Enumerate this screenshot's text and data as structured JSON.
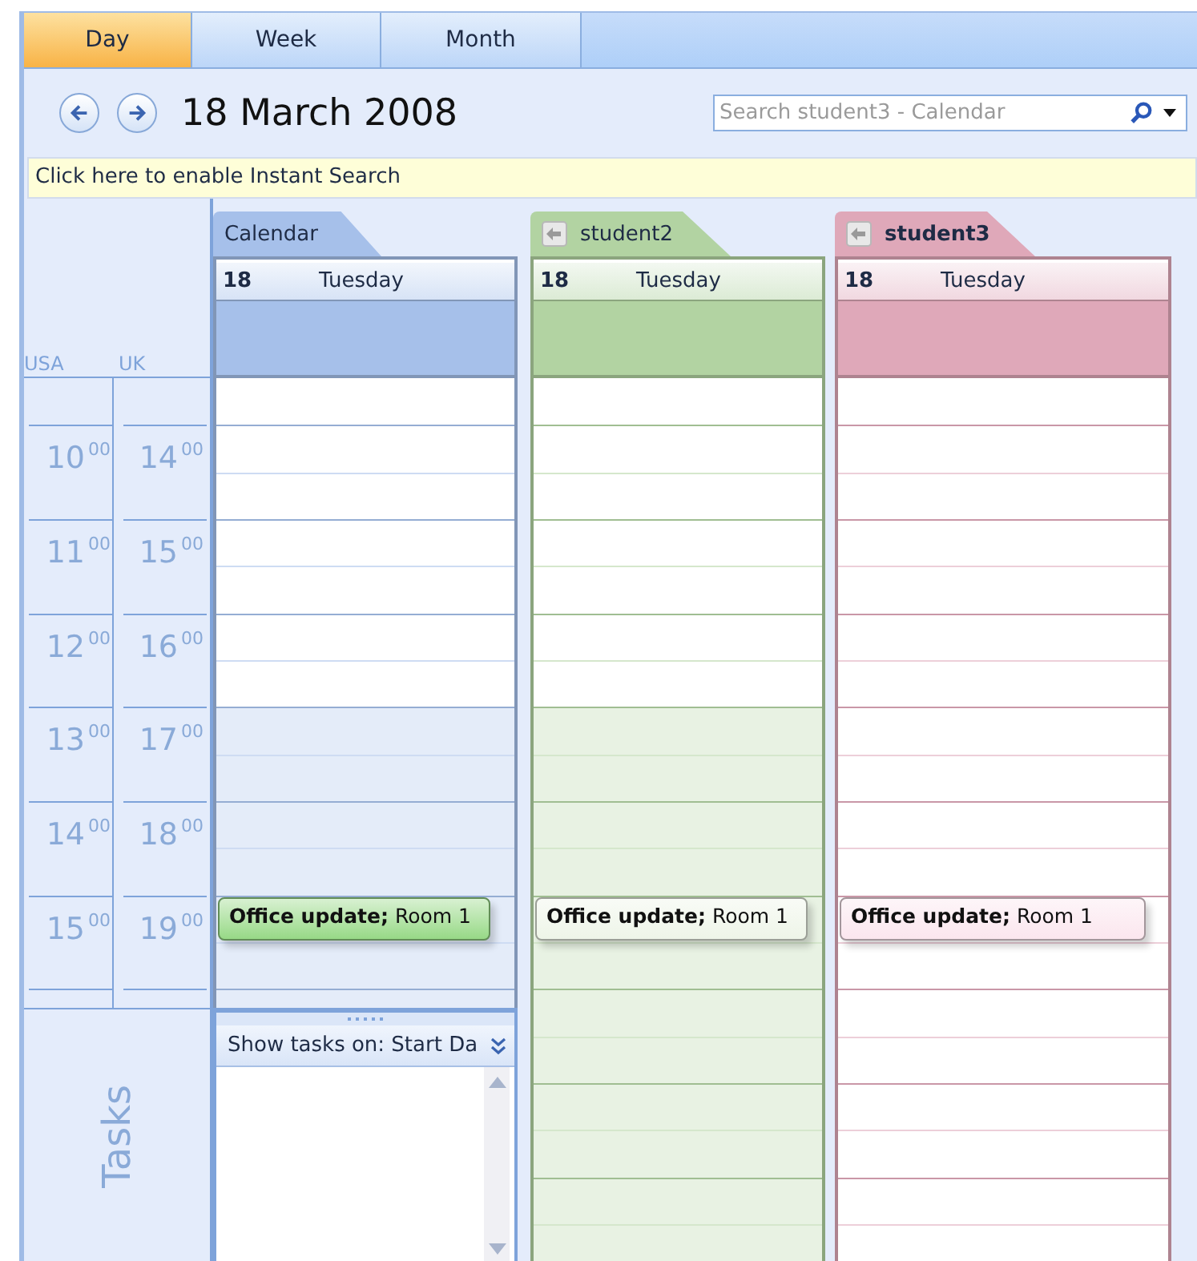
{
  "view_tabs": [
    {
      "label": "Day",
      "selected": true
    },
    {
      "label": "Week",
      "selected": false
    },
    {
      "label": "Month",
      "selected": false
    }
  ],
  "date_title": "18 March 2008",
  "search": {
    "placeholder": "Search student3 - Calendar"
  },
  "instant_search_bar": "Click here to enable Instant Search",
  "time_ruler": {
    "zones": [
      "USA",
      "UK"
    ],
    "hours": [
      {
        "usa": "10$^{00}$",
        "uk": "14$^{00}$"
      },
      {
        "usa": "11$^{00}$",
        "uk": "15$^{00}$"
      },
      {
        "usa": "12$^{00}$",
        "uk": "16$^{00}$"
      },
      {
        "usa": "13$^{00}$",
        "uk": "17$^{00}$"
      },
      {
        "usa": "14$^{00}$",
        "uk": "18$^{00}$"
      },
      {
        "usa": "15$^{00}$",
        "uk": "19$^{00}$"
      }
    ]
  },
  "calendars": [
    {
      "name": "Calendar",
      "color": "#a6c0ea",
      "selected": false,
      "overlay": false,
      "day_number": "18",
      "weekday": "Tuesday",
      "slots": [
        {
          "off": false
        },
        {
          "off": false
        },
        {
          "off": false
        },
        {
          "off": false
        },
        {
          "off": false
        },
        {
          "off": false
        },
        {
          "off": false
        },
        {
          "off": true
        },
        {
          "off": true
        },
        {
          "off": true
        },
        {
          "off": true
        },
        {
          "off": true,
          "appointment": {
            "text": "**Office update;** Room 1",
            "color": "#97d986"
          }
        },
        {
          "off": true
        },
        {
          "off": true
        }
      ]
    },
    {
      "name": "student2",
      "color": "#b2d3a2",
      "selected": false,
      "overlay": true,
      "day_number": "18",
      "weekday": "Tuesday",
      "slots": [
        {
          "off": false
        },
        {
          "off": false
        },
        {
          "off": false
        },
        {
          "off": false
        },
        {
          "off": false
        },
        {
          "off": false
        },
        {
          "off": false
        },
        {
          "off": true
        },
        {
          "off": true
        },
        {
          "off": true
        },
        {
          "off": true
        },
        {
          "off": true,
          "appointment": {
            "text": "**Office update;** Room 1",
            "color": "#eef5e8"
          }
        },
        {
          "off": true
        },
        {
          "off": true
        },
        {
          "off": true
        },
        {
          "off": true
        },
        {
          "off": true
        },
        {
          "off": true
        },
        {
          "off": true
        }
      ]
    },
    {
      "name": "student3",
      "color": "#dfa8b9",
      "selected": true,
      "overlay": true,
      "day_number": "18",
      "weekday": "Tuesday",
      "slots": [
        {
          "off": false
        },
        {
          "off": false
        },
        {
          "off": false
        },
        {
          "off": false
        },
        {
          "off": false
        },
        {
          "off": false
        },
        {
          "off": false
        },
        {
          "off": false
        },
        {
          "off": false
        },
        {
          "off": false
        },
        {
          "off": false
        },
        {
          "off": false,
          "appointment": {
            "text": "**Office update;** Room 1",
            "color": "#fbe6ee"
          }
        },
        {
          "off": false
        },
        {
          "off": false
        },
        {
          "off": false
        },
        {
          "off": false
        },
        {
          "off": false
        },
        {
          "off": false
        },
        {
          "off": false
        }
      ]
    }
  ],
  "tasks": {
    "title": "Tasks",
    "show_tasks_on": "Show tasks on: Start Da"
  }
}
